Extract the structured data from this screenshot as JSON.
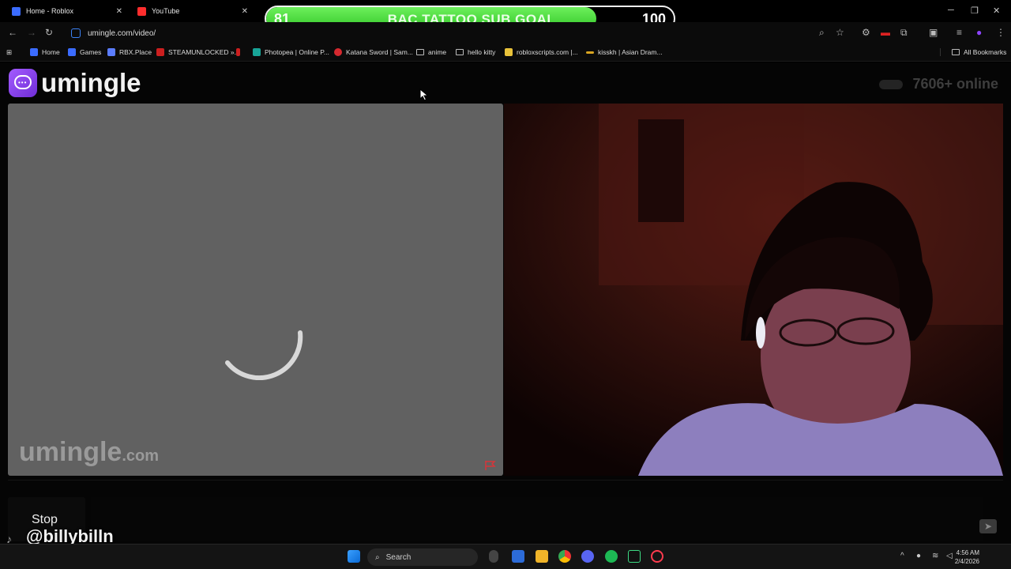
{
  "tabs": [
    {
      "title": "Home - Roblox",
      "favicon_color": "#3b6cff",
      "active": true
    },
    {
      "title": "YouTube",
      "favicon_color": "#ff2d2d",
      "active": false
    }
  ],
  "stream_goal": {
    "start": "81",
    "title": "BAC TATTOO SUB GOAL",
    "end": "100",
    "progress": 0.81,
    "accent": "#3fd332"
  },
  "address_bar": {
    "url": "umingle.com/video/"
  },
  "bookmarks": [
    {
      "label": "Home",
      "kind": "site",
      "color": "#3b6cff"
    },
    {
      "label": "Games",
      "kind": "site",
      "color": "#3b6cff"
    },
    {
      "label": "RBX.Place",
      "kind": "site",
      "color": "#5b7dff"
    },
    {
      "label": "STEAMUNLOCKED »...",
      "kind": "site",
      "color": "#cc1f1f"
    },
    {
      "label": "",
      "kind": "site",
      "color": "#cc1f1f"
    },
    {
      "label": "Photopea | Online P...",
      "kind": "site",
      "color": "#18a497"
    },
    {
      "label": "Katana Sword | Sam...",
      "kind": "site",
      "color": "#d6292f"
    },
    {
      "label": "anime",
      "kind": "folder"
    },
    {
      "label": "hello kitty",
      "kind": "folder"
    },
    {
      "label": "robloxscripts.com |...",
      "kind": "site",
      "color": "#e8c23a"
    },
    {
      "label": "kisskh | Asian Dram...",
      "kind": "site",
      "color": "#d9a521"
    }
  ],
  "all_bookmarks_label": "All Bookmarks",
  "site": {
    "brand": "umingle",
    "online_count": "7606+ online",
    "watermark_main": "umingle",
    "watermark_tld": ".com",
    "brand_color": "#8e44ff",
    "stop_label": "Stop",
    "send_icon": "send-icon"
  },
  "overlay": {
    "handle": "@billybilln"
  },
  "taskbar": {
    "search_placeholder": "Search",
    "time": "4:56 AM",
    "date": "2/4/2026"
  }
}
